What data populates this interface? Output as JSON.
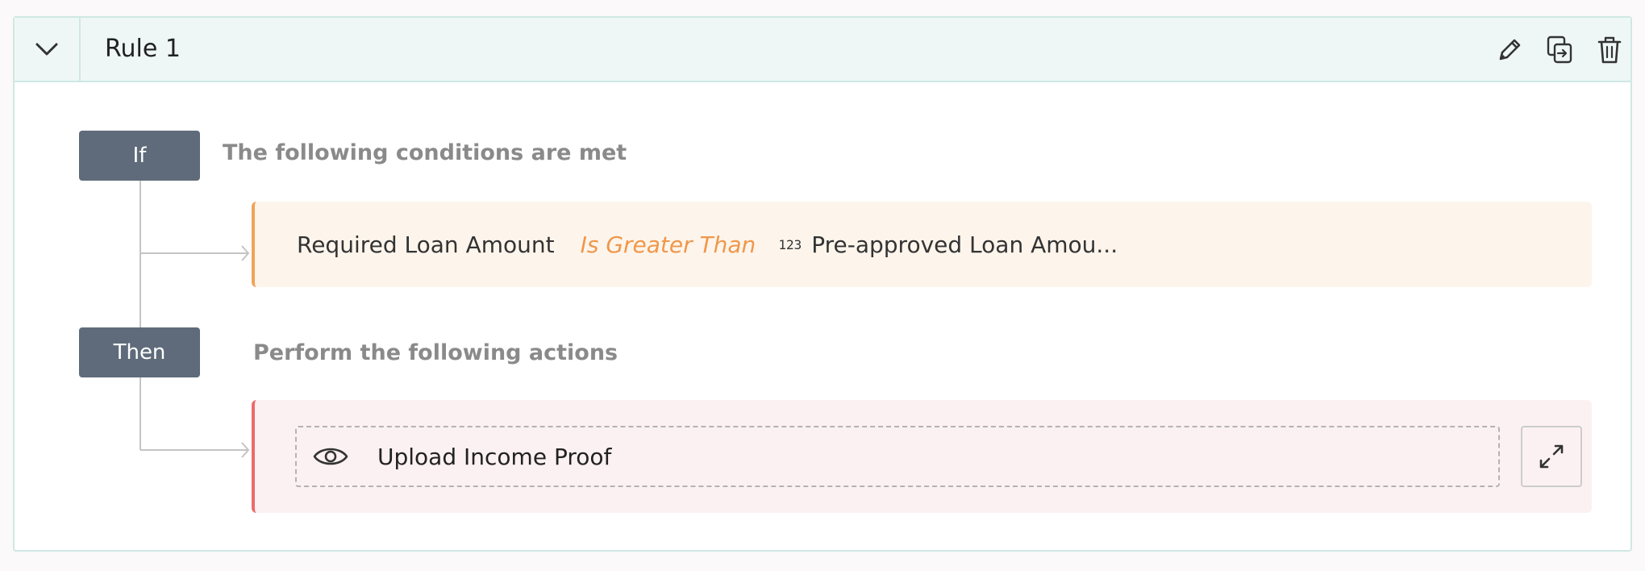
{
  "rule": {
    "title": "Rule 1",
    "if_label": "If",
    "if_description": "The following conditions are met",
    "then_label": "Then",
    "then_description": "Perform the following actions",
    "condition": {
      "field": "Required Loan Amount",
      "operator": "Is Greater Than",
      "value_type_icon": "123",
      "value": "Pre-approved Loan Amou..."
    },
    "action": {
      "icon": "eye-icon",
      "label": "Upload Income Proof"
    }
  },
  "header_actions": [
    {
      "icon": "pencil-icon"
    },
    {
      "icon": "copy-icon"
    },
    {
      "icon": "trash-icon"
    }
  ],
  "colors": {
    "header_bg": "#eff7f6",
    "border": "#cfe8e3",
    "badge_bg": "#5f6b7a",
    "condition_bg": "#fdf5ec",
    "condition_accent": "#f0a35a",
    "operator_text": "#f0974a",
    "action_bg": "#fcf1f2",
    "action_accent": "#eb6b6b"
  }
}
